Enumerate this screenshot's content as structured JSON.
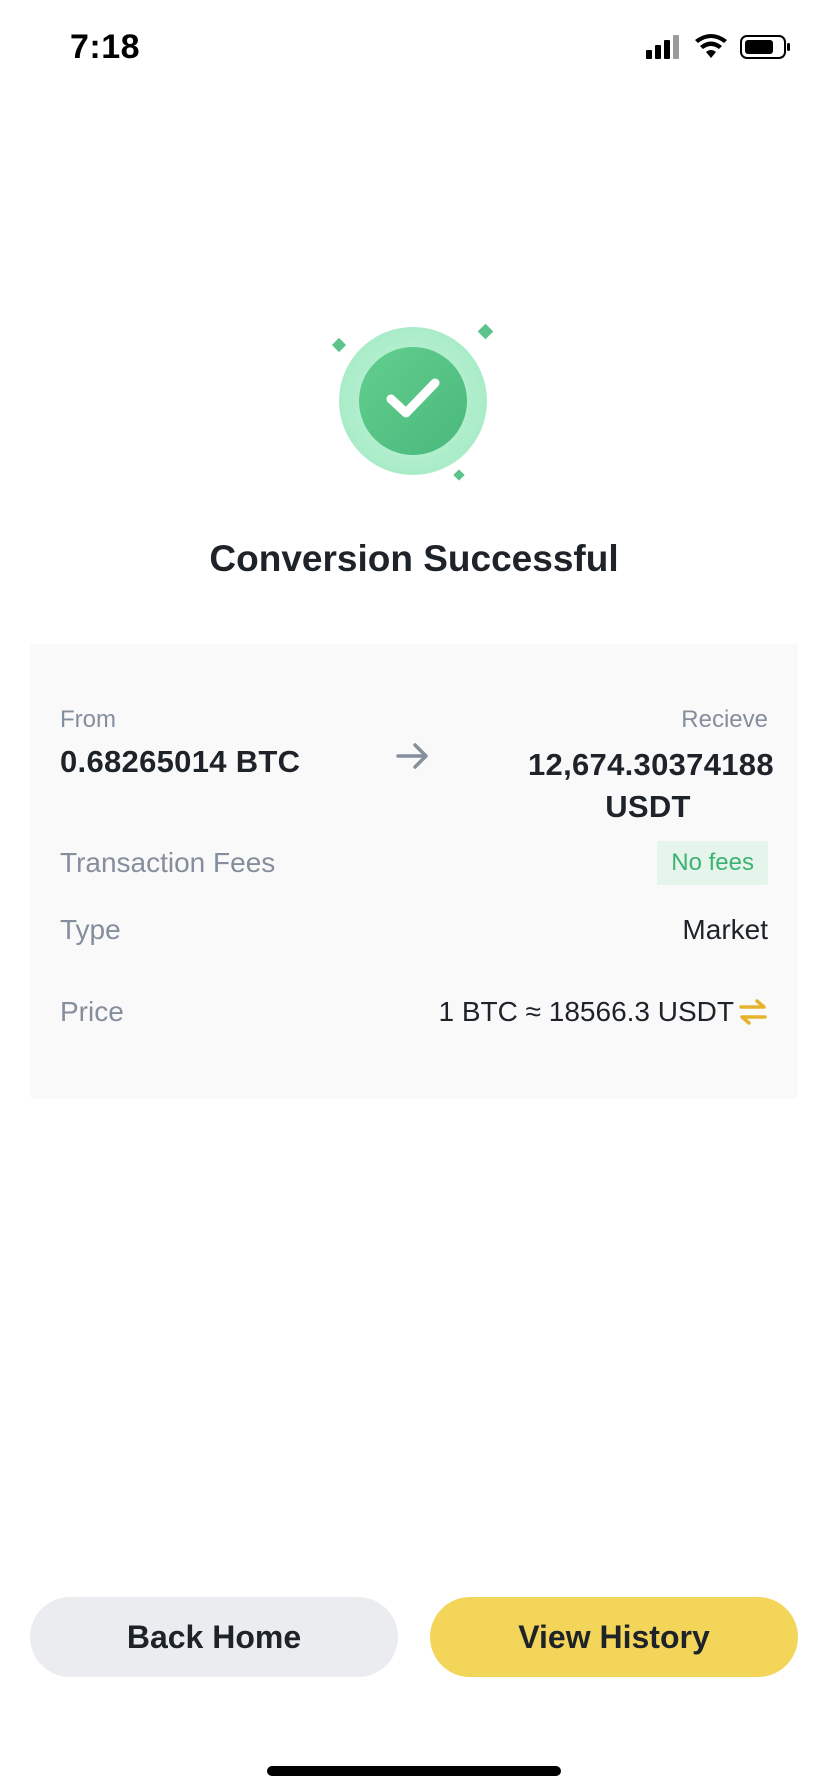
{
  "status_bar": {
    "time": "7:18"
  },
  "title": "Conversion Successful",
  "details": {
    "from_label": "From",
    "from_amount": "0.68265014 BTC",
    "receive_label": "Recieve",
    "receive_amount": "12,674.30374188 USDT",
    "fees_label": "Transaction Fees",
    "fees_value": "No fees",
    "type_label": "Type",
    "type_value": "Market",
    "price_label": "Price",
    "price_value": "1 BTC ≈ 18566.3 USDT"
  },
  "buttons": {
    "back_home": "Back Home",
    "view_history": "View History"
  },
  "colors": {
    "success_green": "#5cc48a",
    "accent_yellow": "#f3d55a",
    "swap_icon": "#e5b42f",
    "fees_badge_text": "#3cb371"
  },
  "icons": {
    "status": [
      "signal-icon",
      "wifi-icon",
      "battery-icon"
    ],
    "success": "check-icon",
    "arrow": "arrow-right-icon",
    "swap": "swap-icon"
  }
}
